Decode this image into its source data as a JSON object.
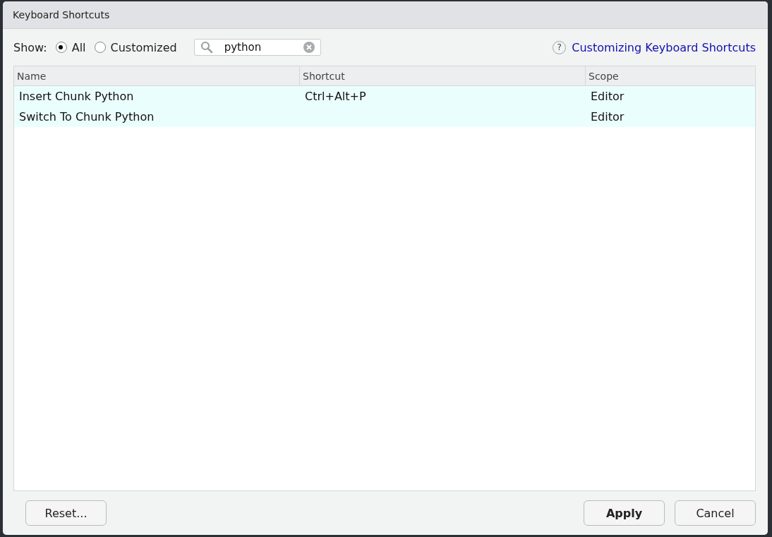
{
  "window": {
    "title": "Keyboard Shortcuts"
  },
  "filter": {
    "label": "Show:",
    "options": [
      {
        "label": "All",
        "selected": true
      },
      {
        "label": "Customized",
        "selected": false
      }
    ]
  },
  "search": {
    "value": "python"
  },
  "help_link": {
    "icon": "?",
    "label": "Customizing Keyboard Shortcuts"
  },
  "table": {
    "columns": [
      "Name",
      "Shortcut",
      "Scope"
    ],
    "rows": [
      {
        "cells": [
          "Insert Chunk Python",
          "Ctrl+Alt+P",
          "Editor"
        ],
        "selected": true
      },
      {
        "cells": [
          "Switch To Chunk Python",
          "",
          "Editor"
        ],
        "selected": true
      }
    ]
  },
  "buttons": {
    "left": [
      {
        "label": "Reset...",
        "default": false
      }
    ],
    "right": [
      {
        "label": "Apply",
        "default": true
      },
      {
        "label": "Cancel",
        "default": false
      }
    ]
  }
}
